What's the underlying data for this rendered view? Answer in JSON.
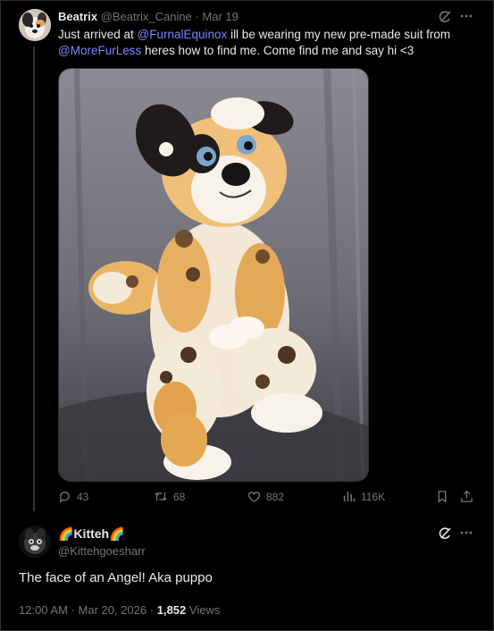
{
  "tweet": {
    "author_name": "Beatrix",
    "handle": "@Beatrix_Canine",
    "separator": "·",
    "date": "Mar 19",
    "text_parts": [
      "Just arrived at ",
      "@FurnalEquinox",
      " ill be wearing my new pre-made suit from ",
      "@MoreFurLess",
      " heres how to find me. Come find me and say hi <3"
    ],
    "stats": {
      "replies": "43",
      "retweets": "68",
      "likes": "882",
      "views": "116K"
    }
  },
  "reply": {
    "name_emoji_left": "🌈",
    "name": "Kitteh",
    "name_emoji_right": "🌈",
    "handle": "@Kittehgoesharr",
    "text": "The face of an Angel! Aka puppo",
    "time": "12:00 AM",
    "separator": "·",
    "date": "Mar 20, 2026",
    "separator2": "·",
    "views_count": "1,852",
    "views_label": "Views"
  },
  "icons": {
    "grok": "grok-icon",
    "more": "more-icon",
    "reply": "reply-icon",
    "retweet": "retweet-icon",
    "like": "heart-icon",
    "views": "views-icon",
    "bookmark": "bookmark-icon",
    "share": "share-icon"
  },
  "colors": {
    "background": "#000000",
    "text": "#e7e9ea",
    "muted": "#71767b",
    "mention": "#7c85ff",
    "border": "#2f3336"
  }
}
